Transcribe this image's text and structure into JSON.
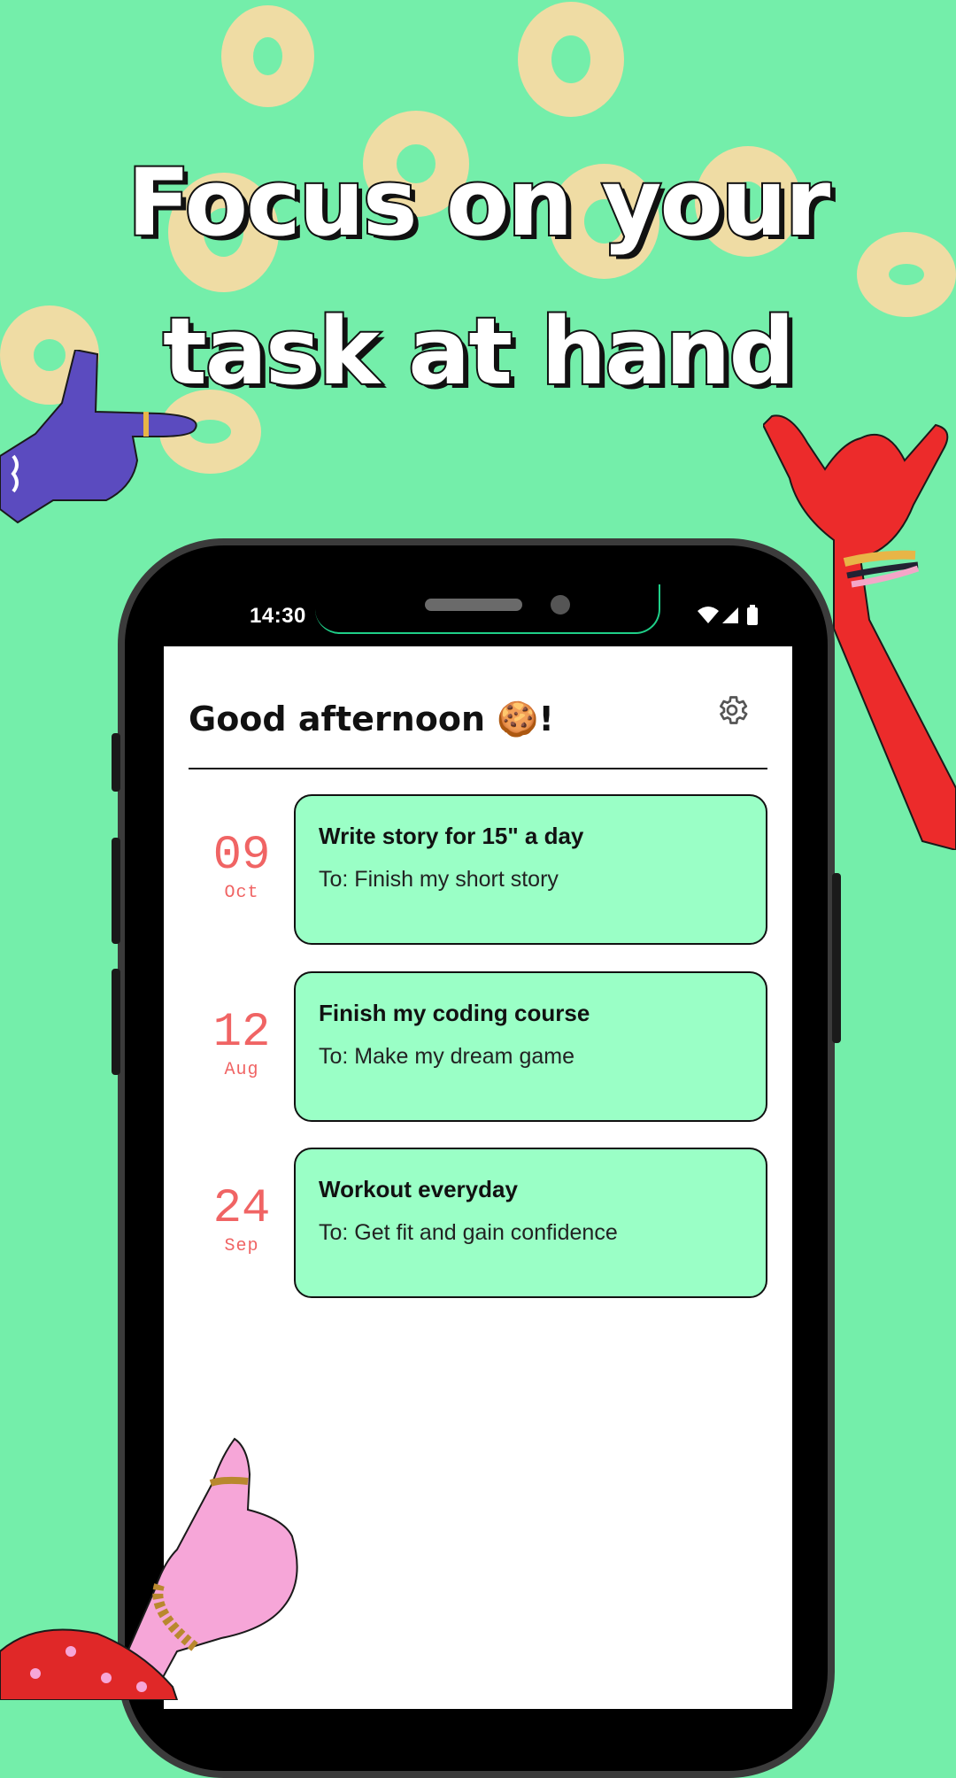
{
  "headline": {
    "line1": "Focus on your",
    "line2": "task at hand"
  },
  "status_bar": {
    "time": "14:30"
  },
  "app": {
    "greeting": "Good afternoon 🍪!",
    "settings_icon": "gear-icon"
  },
  "tasks": [
    {
      "day": "09",
      "month": "Oct",
      "title": "Write story for 15\" a day",
      "goal": "To: Finish my short story"
    },
    {
      "day": "12",
      "month": "Aug",
      "title": "Finish my coding course",
      "goal": "To: Make my dream game"
    },
    {
      "day": "24",
      "month": "Sep",
      "title": "Workout everyday",
      "goal": "To: Get fit and gain confidence"
    }
  ],
  "colors": {
    "background": "#74EEAA",
    "card": "#9AFFC6",
    "date": "#F06464",
    "ring": "#EFDCA4"
  }
}
